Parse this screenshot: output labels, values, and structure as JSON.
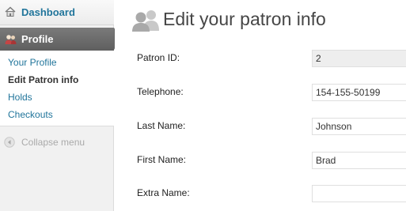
{
  "sidebar": {
    "dashboard": {
      "label": "Dashboard",
      "icon": "dashboard-icon"
    },
    "profile": {
      "label": "Profile",
      "icon": "users-icon"
    },
    "submenu": [
      {
        "label": "Your Profile",
        "current": false
      },
      {
        "label": "Edit Patron info",
        "current": true
      },
      {
        "label": "Holds",
        "current": false
      },
      {
        "label": "Checkouts",
        "current": false
      }
    ],
    "collapse": {
      "label": "Collapse menu",
      "icon": "collapse-arrow-icon"
    }
  },
  "main": {
    "title": "Edit your patron info",
    "title_icon": "users-icon",
    "fields": [
      {
        "label": "Patron ID:",
        "value": "2",
        "readonly": true
      },
      {
        "label": "Telephone:",
        "value": "154-155-50199",
        "readonly": false
      },
      {
        "label": "Last Name:",
        "value": "Johnson",
        "readonly": false
      },
      {
        "label": "First Name:",
        "value": "Brad",
        "readonly": false
      },
      {
        "label": "Extra Name:",
        "value": "",
        "readonly": false
      }
    ]
  },
  "colors": {
    "link": "#21759b",
    "active_menu": "#6a6a6a",
    "sidebar_bg": "#f1f1f1"
  }
}
